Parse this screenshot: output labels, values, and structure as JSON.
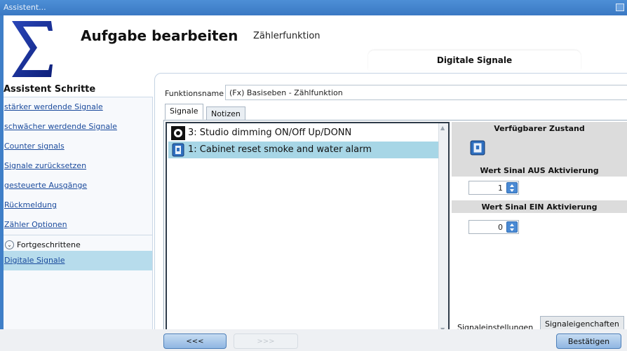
{
  "window": {
    "title": "Assistent..."
  },
  "header": {
    "title": "Aufgabe bearbeiten",
    "subtitle": "Zählerfunktion",
    "section_tab": "Digitale Signale"
  },
  "sidebar": {
    "title": "Assistent Schritte",
    "items": [
      {
        "label": "stärker werdende Signale"
      },
      {
        "label": "schwächer werdende Signale"
      },
      {
        "label": "Counter signals"
      },
      {
        "label": "Signale zurücksetzen"
      },
      {
        "label": "gesteuerte Ausgänge"
      },
      {
        "label": "Rückmeldung"
      },
      {
        "label": "Zähler Optionen"
      }
    ],
    "advanced_label": "Fortgeschrittene",
    "active_item": "Digitale Signale"
  },
  "form": {
    "function_name_label": "Funktionsname",
    "function_name_value": "(Fx) Basiseben - Zählfunktion"
  },
  "tabs": [
    {
      "label": "Signale"
    },
    {
      "label": "Notizen"
    }
  ],
  "signals": [
    {
      "label": "3: Studio dimming ON/Off Up/DONN",
      "icon": "dimmer-icon"
    },
    {
      "label": "1: Cabinet reset smoke and water alarm",
      "icon": "switch-icon",
      "selected": true
    }
  ],
  "properties": {
    "available_state_label": "Verfügbarer Zustand",
    "off_label": "Wert Sinal AUS Aktivierung",
    "off_value": "1",
    "on_label": "Wert Sinal EIN Aktivierung",
    "on_value": "0"
  },
  "bottom_tabs": [
    {
      "label": "Signaleinstellungen"
    },
    {
      "label": "Signaleigenchaften"
    }
  ],
  "nav": {
    "back": "<<<",
    "next": ">>>",
    "confirm": "Bestätigen"
  },
  "colors": {
    "titlebar": "#3a78c3",
    "selection": "#a7d6e6",
    "spin_button": "#4a8ad4"
  }
}
